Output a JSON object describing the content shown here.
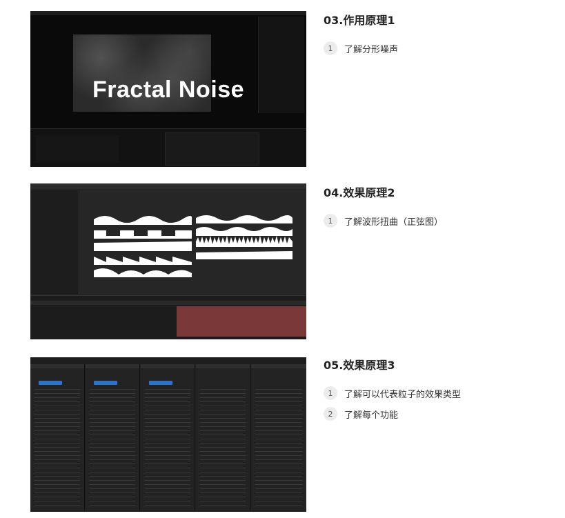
{
  "cards": [
    {
      "title": "03.作用原理1",
      "thumbnail_text": "Fractal Noise",
      "items": [
        {
          "index": "1",
          "label": "了解分形噪声"
        }
      ]
    },
    {
      "title": "04.效果原理2",
      "items": [
        {
          "index": "1",
          "label": "了解波形扭曲（正弦图）"
        }
      ]
    },
    {
      "title": "05.效果原理3",
      "items": [
        {
          "index": "1",
          "label": "了解可以代表粒子的效果类型"
        },
        {
          "index": "2",
          "label": "了解每个功能"
        }
      ]
    }
  ]
}
